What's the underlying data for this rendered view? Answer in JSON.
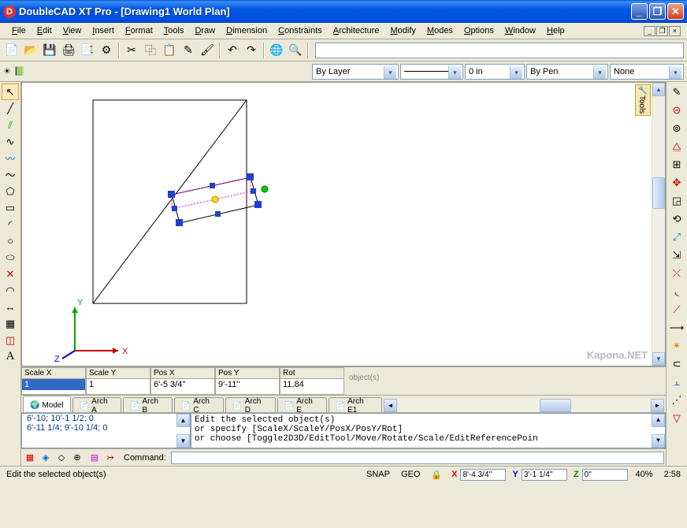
{
  "window": {
    "app_icon_letter": "D",
    "title": "DoubleCAD XT Pro - [Drawing1 World Plan]"
  },
  "menu": [
    "File",
    "Edit",
    "View",
    "Insert",
    "Format",
    "Tools",
    "Draw",
    "Dimension",
    "Constraints",
    "Architecture",
    "Modify",
    "Modes",
    "Options",
    "Window",
    "Help"
  ],
  "properties": {
    "layer": "By Layer",
    "lineweight": "0 in",
    "color": "By Pen",
    "ltype": "None"
  },
  "tools_tab_label": "Tools",
  "axes": {
    "x": "X",
    "y": "Y",
    "z": "Z"
  },
  "params": {
    "scalex": {
      "label": "Scale X",
      "value": "1"
    },
    "scaley": {
      "label": "Scale Y",
      "value": "1"
    },
    "posx": {
      "label": "Pos X",
      "value": "6'-5 3/4''"
    },
    "posy": {
      "label": "Pos Y",
      "value": "9'-11''"
    },
    "rot": {
      "label": "Rot",
      "value": "11,84"
    }
  },
  "param_hint": "object(s)",
  "tabs": [
    "Model",
    "Arch A",
    "Arch B",
    "Arch C",
    "Arch D",
    "Arch E",
    "Arch E1"
  ],
  "history": [
    "6'-10; 10'-1 1/2; 0",
    "6'-11 1/4; 9'-10 1/4; 0"
  ],
  "cmd_output": [
    "Edit the selected object(s)",
    "  or specify [ScaleX/ScaleY/PosX/PosY/Rot]",
    "  or choose [Toggle2D3D/EditTool/Move/Rotate/Scale/EditReferencePoin"
  ],
  "cmd_label": "Command:",
  "status": {
    "hint": "Edit the selected object(s)",
    "snap": "SNAP",
    "geo": "GEO",
    "x": "8'-4 3/4''",
    "y": "3'-1 1/4''",
    "z": "0''",
    "zoom": "40%",
    "time": "2:58"
  },
  "watermark": "Kapona.NET"
}
